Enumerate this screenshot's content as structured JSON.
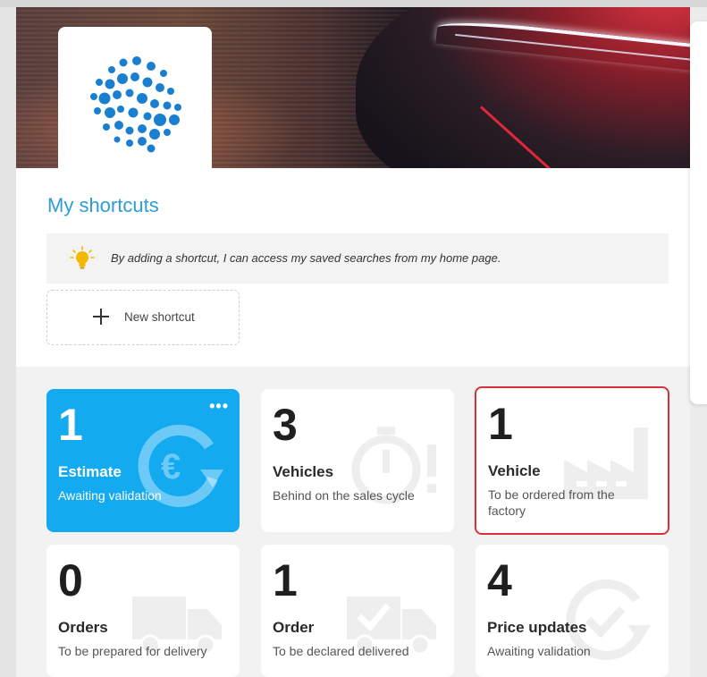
{
  "section_title": "My shortcuts",
  "tip_text": "By adding a shortcut, I can access my saved searches from my home page.",
  "new_shortcut_label": "New shortcut",
  "tiles": [
    {
      "count": "1",
      "title": "Estimate",
      "subtitle": "Awaiting validation",
      "icon": "euro-refresh-icon",
      "style": "blue"
    },
    {
      "count": "3",
      "title": "Vehicles",
      "subtitle": "Behind on the sales cycle",
      "icon": "stopwatch-alert-icon",
      "style": "white"
    },
    {
      "count": "1",
      "title": "Vehicle",
      "subtitle": "To be ordered from the factory",
      "icon": "factory-icon",
      "style": "red-outline"
    },
    {
      "count": "0",
      "title": "Orders",
      "subtitle": "To be prepared for delivery",
      "icon": "truck-icon",
      "style": "white"
    },
    {
      "count": "1",
      "title": "Order",
      "subtitle": "To be declared delivered",
      "icon": "truck-check-icon",
      "style": "white"
    },
    {
      "count": "4",
      "title": "Price updates",
      "subtitle": "Awaiting validation",
      "icon": "check-refresh-icon",
      "style": "white"
    }
  ],
  "colors": {
    "accent": "#2e9cd8",
    "tile_blue": "#14aaf0",
    "alert_red": "#d8313b",
    "bulb": "#f5b800"
  }
}
